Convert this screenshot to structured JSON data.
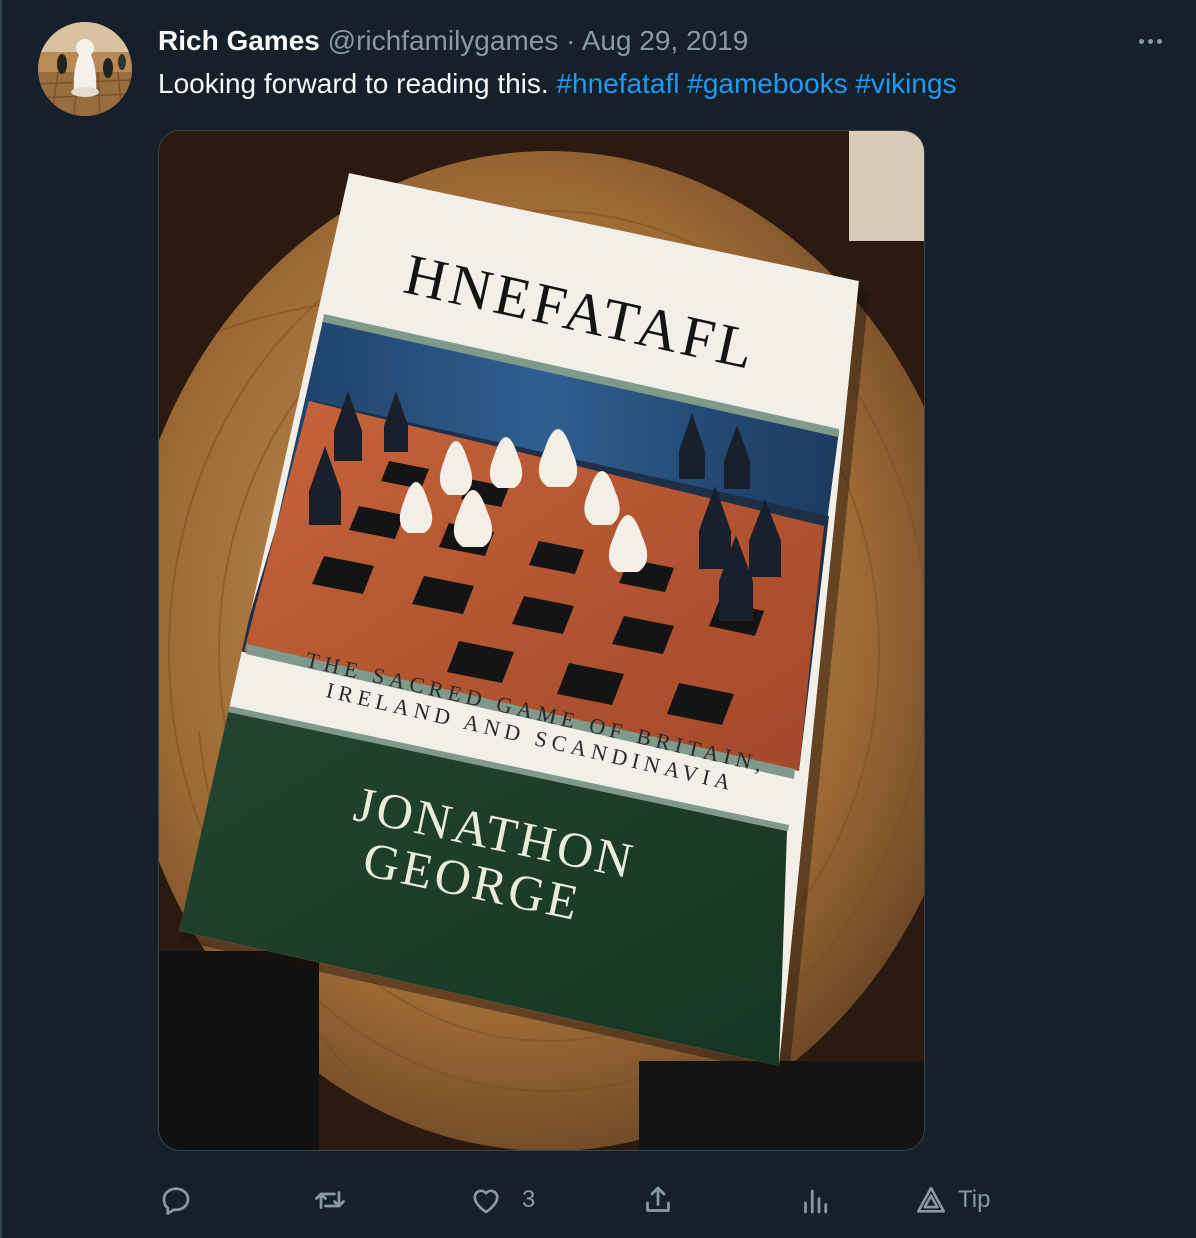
{
  "tweet": {
    "author_name": "Rich Games",
    "handle": "@richfamilygames",
    "separator": "·",
    "date": "Aug 29, 2019",
    "text_plain": "Looking forward to reading this.",
    "hashtags": [
      "#hnefatafl",
      "#gamebooks",
      "#vikings"
    ]
  },
  "book": {
    "title": "HNEFATAFL",
    "subtitle_line1": "THE SACRED GAME OF BRITAIN,",
    "subtitle_line2": "IRELAND AND SCANDINAVIA",
    "author_line1": "JONATHON",
    "author_line2": "GEORGE"
  },
  "actions": {
    "reply_icon": "reply-icon",
    "retweet_icon": "retweet-icon",
    "like_icon": "heart-icon",
    "like_count": "3",
    "share_icon": "share-icon",
    "analytics_icon": "analytics-icon",
    "tip_icon": "tip-icon",
    "tip_label": "Tip"
  },
  "colors": {
    "background": "#15202b",
    "hashtag": "#1d9bf0",
    "muted": "#8b98a5"
  }
}
